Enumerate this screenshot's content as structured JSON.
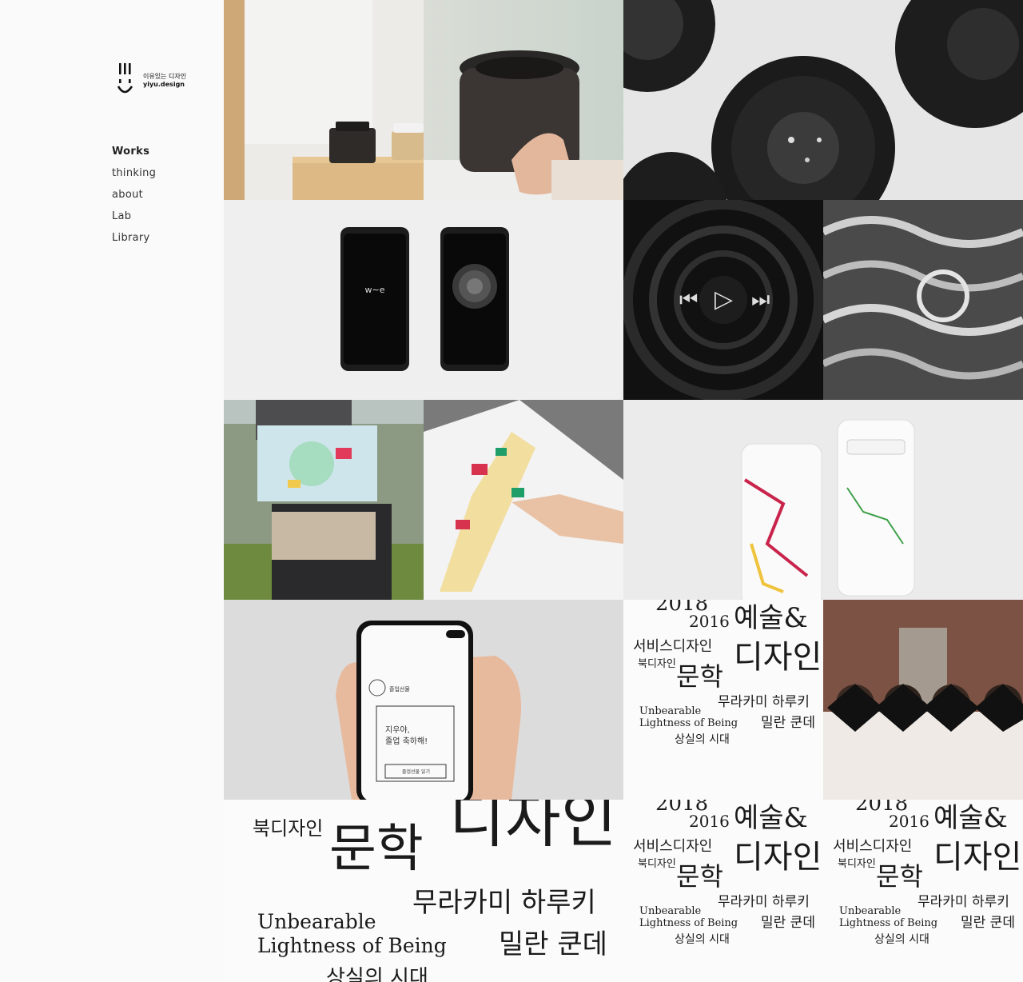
{
  "brand": {
    "name_ko": "이유있는 디자인",
    "name_en": "yiyu.design"
  },
  "nav": [
    {
      "label": "Works",
      "active": true
    },
    {
      "label": "thinking",
      "active": false
    },
    {
      "label": "about",
      "active": false
    },
    {
      "label": "Lab",
      "active": false
    },
    {
      "label": "Library",
      "active": false
    }
  ],
  "wave_app": {
    "logo": "wave"
  },
  "graduation_app": {
    "header": "졸업선물",
    "message_line1": "지우야,",
    "message_line2": "졸업 축하해!",
    "button": "졸업선물 읽기"
  },
  "typography": {
    "year1": "2018",
    "year2": "2016",
    "art": "예술&",
    "service": "서비스디자인",
    "book": "북디자인",
    "design": "디자인",
    "literature": "문학",
    "murakami": "무라카미 하루키",
    "kundera": "밀란 쿤데",
    "book_en_line1": "Unbearable",
    "book_en_line2": "Lightness of Being",
    "era": "상실의 시대"
  },
  "icons": [
    "logo-mark-icon",
    "prev-track-icon",
    "play-icon",
    "next-track-icon"
  ]
}
